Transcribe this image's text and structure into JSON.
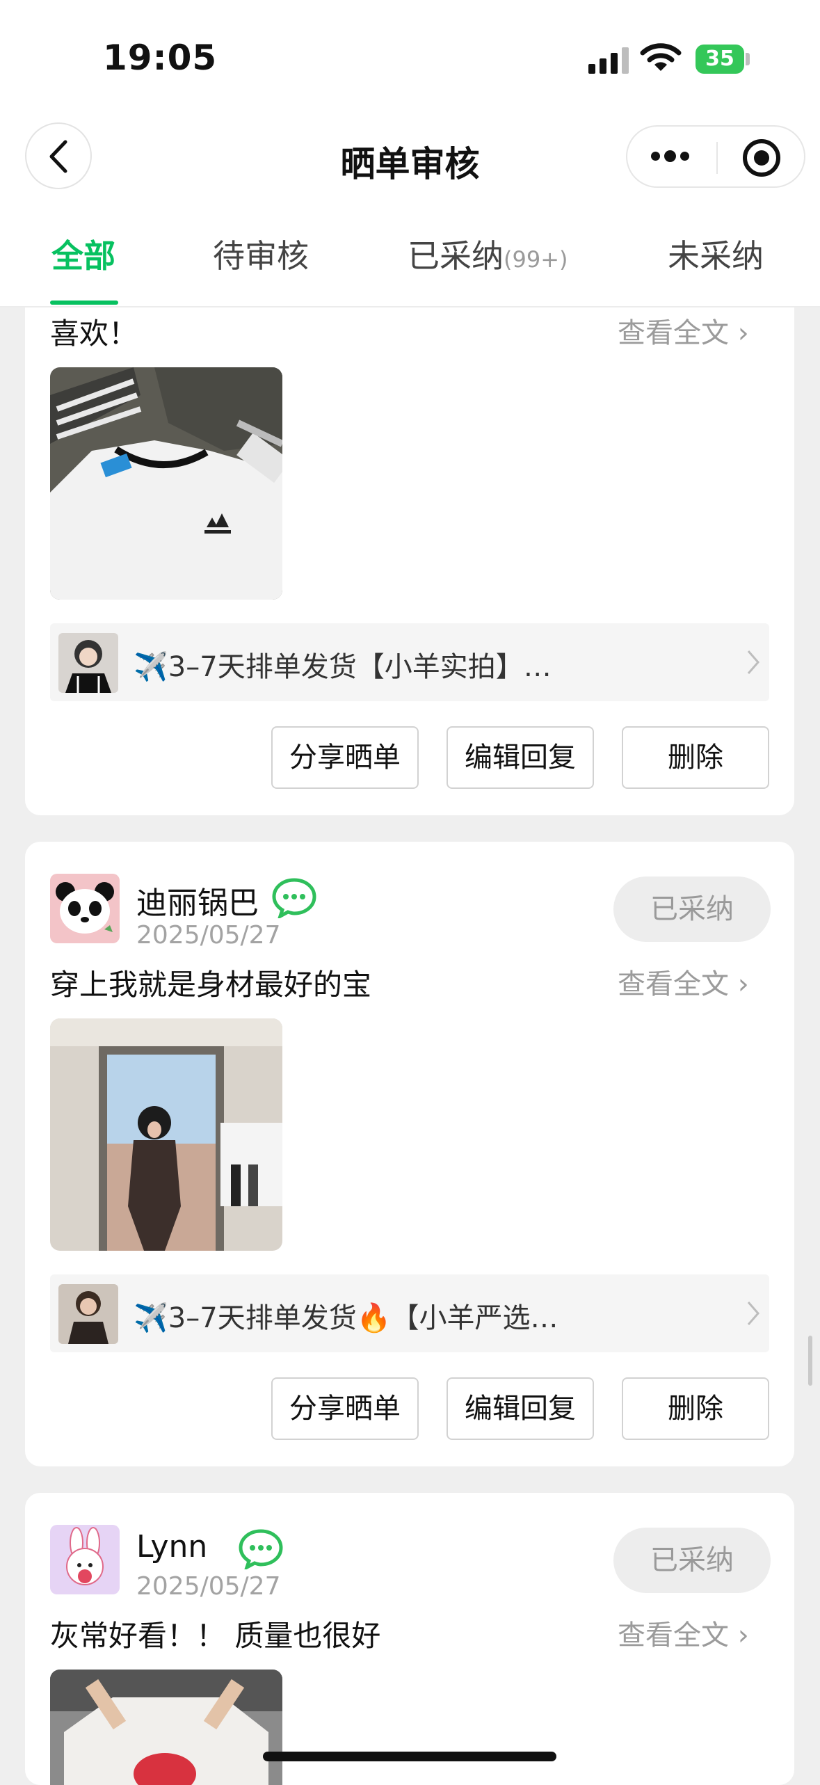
{
  "status_bar": {
    "time": "19:05",
    "battery": "35"
  },
  "nav": {
    "title": "晒单审核"
  },
  "tabs": [
    {
      "label": "全部",
      "active": true
    },
    {
      "label": "待审核"
    },
    {
      "label": "已采纳",
      "count": "(99+)"
    },
    {
      "label": "未采纳"
    }
  ],
  "reviews": [
    {
      "content": "喜欢！",
      "read_more": "查看全文",
      "product_title": "✈️3–7天排单发货【小羊实拍】…",
      "actions": [
        "分享晒单",
        "编辑回复",
        "删除"
      ]
    },
    {
      "user": "迪丽锅巴",
      "date": "2025/05/27",
      "status": "已采纳",
      "content": "穿上我就是身材最好的宝",
      "read_more": "查看全文",
      "product_title": "✈️3–7天排单发货🔥【小羊严选…",
      "actions": [
        "分享晒单",
        "编辑回复",
        "删除"
      ]
    },
    {
      "user": "Lynn",
      "date": "2025/05/27",
      "status": "已采纳",
      "content": "灰常好看！！ 质量也很好",
      "read_more": "查看全文"
    }
  ],
  "colors": {
    "accent": "#07c160",
    "wechat_green": "#2fbf5b",
    "page_bg": "#efefef"
  }
}
